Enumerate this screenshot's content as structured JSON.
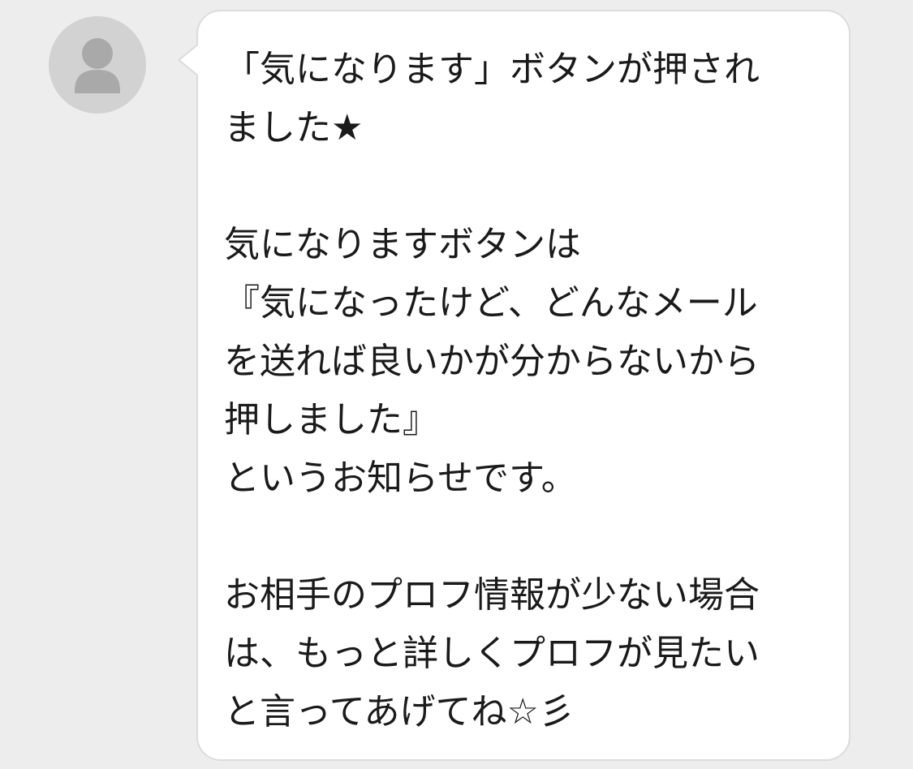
{
  "sender": {
    "avatar_icon": "person-silhouette-icon"
  },
  "message": {
    "lines": [
      "「気になります」ボタンが押され",
      "ました★",
      "",
      "気になりますボタンは",
      "『気になったけど、どんなメール",
      "を送れば良いかが分からないから",
      "押しました』",
      "というお知らせです。",
      "",
      "お相手のプロフ情報が少ない場合",
      "は、もっと詳しくプロフが見たい",
      "と言ってあげてね☆彡"
    ]
  },
  "colors": {
    "background": "#ededed",
    "bubble": "#ffffff",
    "avatar": "#d2d2d2",
    "text": "#1a1a1a"
  }
}
